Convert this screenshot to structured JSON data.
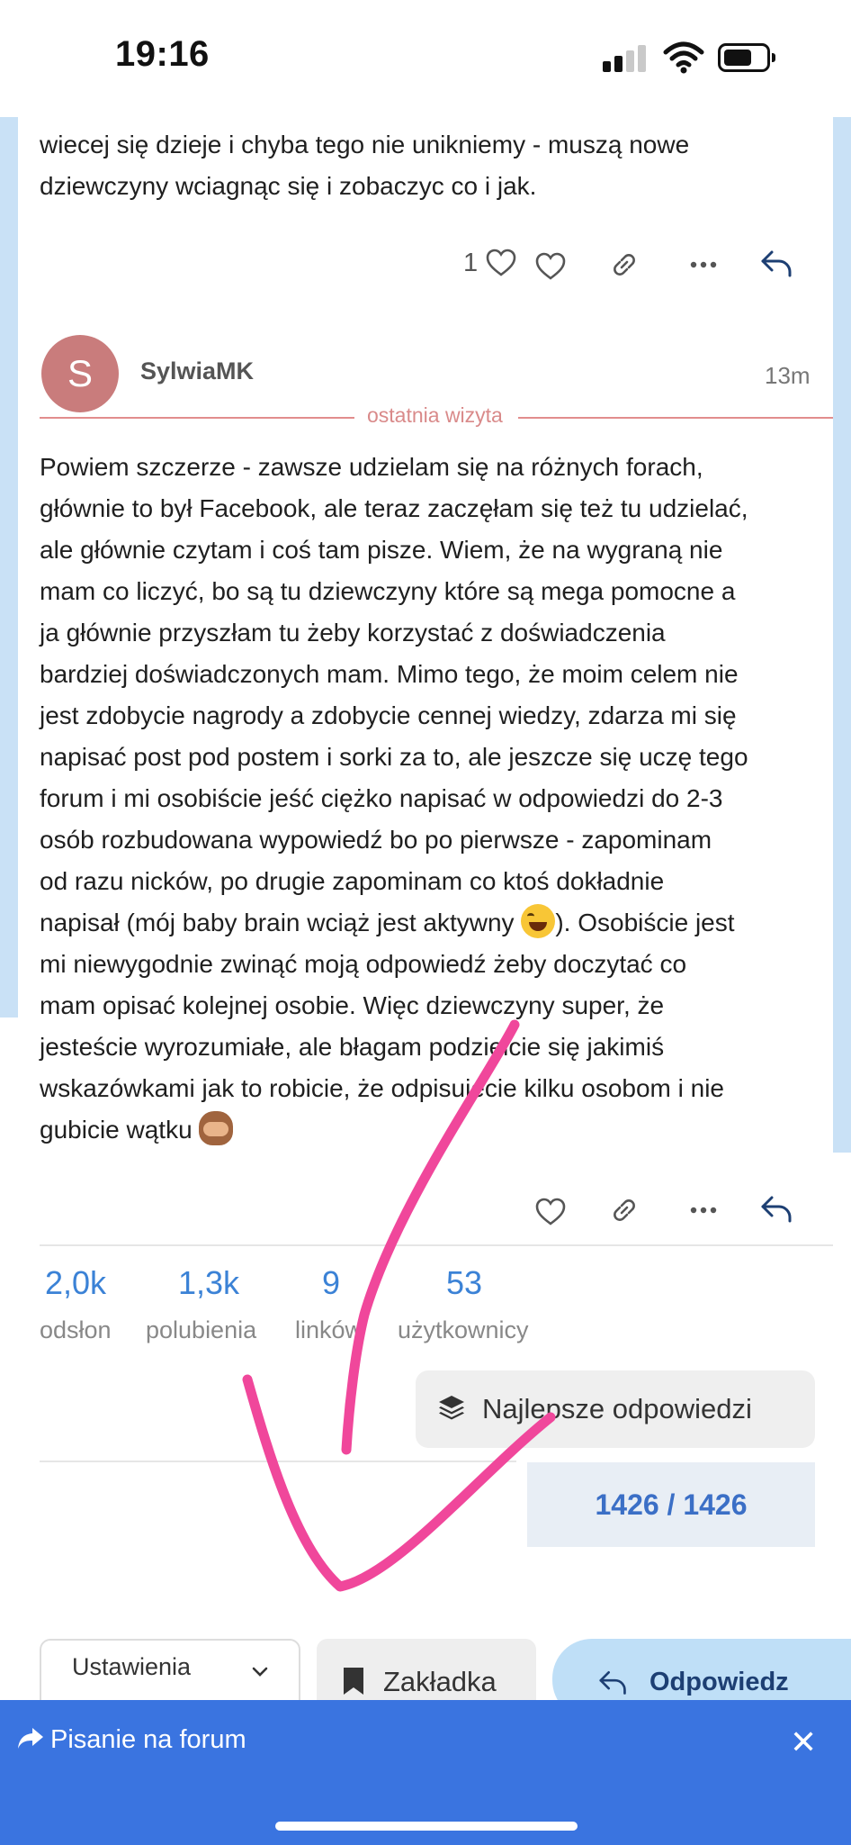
{
  "status_bar": {
    "time": "19:16"
  },
  "prev_post": {
    "text_lines": [
      "wiecej się dzieje i chyba tego nie unikniemy - muszą nowe",
      "dziewczyny wciagnąc się i zobaczyc co i jak."
    ],
    "like_count": "1"
  },
  "last_visit_label": "ostatnia wizyta",
  "post": {
    "avatar_letter": "S",
    "username": "SylwiaMK",
    "time": "13m",
    "lines": [
      "Powiem szczerze - zawsze udzielam się na różnych forach,",
      "głównie to był Facebook, ale teraz zaczęłam się też tu udzielać,",
      "ale głównie czytam i coś tam pisze. Wiem, że na wygraną nie",
      "mam co liczyć, bo są tu dziewczyny które są mega pomocne a",
      "ja głównie przyszłam tu żeby korzystać z doświadczenia",
      "bardziej doświadczonych mam. Mimo tego, że moim celem nie",
      "jest zdobycie nagrody a zdobycie cennej wiedzy, zdarza mi się",
      "napisać post pod postem i sorki za to, ale jeszcze się uczę tego",
      "forum i mi osobiście jeść ciężko napisać w odpowiedzi do 2-3",
      "osób rozbudowana wypowiedź bo po pierwsze - zapominam",
      "od razu nicków, po drugie zapominam co ktoś dokładnie"
    ],
    "line12_before": "napisał (mój baby brain wciąż jest aktywny ",
    "line12_after": "). Osobiście jest",
    "lines_end": [
      "mi niewygodnie zwinąć moją odpowiedź żeby doczytać co",
      "mam opisać kolejnej osobie. Więc dziewczyny super, że",
      "jesteście wyrozumiałe, ale błagam podzielcie się jakimiś",
      "wskazówkami jak to robicie, że odpisujecie kilku osobom i nie"
    ],
    "last_line": "gubicie wątku "
  },
  "stats": [
    {
      "value": "2,0k",
      "label": "odsłon"
    },
    {
      "value": "1,3k",
      "label": "polubienia"
    },
    {
      "value": "9",
      "label": "linków"
    },
    {
      "value": "53",
      "label": "użytkownicy"
    }
  ],
  "best_answers_label": "Najlepsze odpowiedzi",
  "progress": {
    "text": "1426 / 1426"
  },
  "bottom_actions": {
    "settings_label": "Ustawienia",
    "bookmark_label": "Zakładka",
    "reply_label": "Odpowiedz"
  },
  "footer": {
    "label": "Pisanie na forum",
    "close": "✕"
  },
  "colors": {
    "accent": "#3a74e0",
    "stat_blue": "#3b82d6",
    "divider": "#e28d8d",
    "annotation_pink": "#f0479b"
  },
  "icons": [
    "heart-icon",
    "link-icon",
    "more-icon",
    "reply-icon",
    "layers-icon",
    "bookmark-icon",
    "chevron-down-icon",
    "share-arrow-icon",
    "close-icon"
  ]
}
